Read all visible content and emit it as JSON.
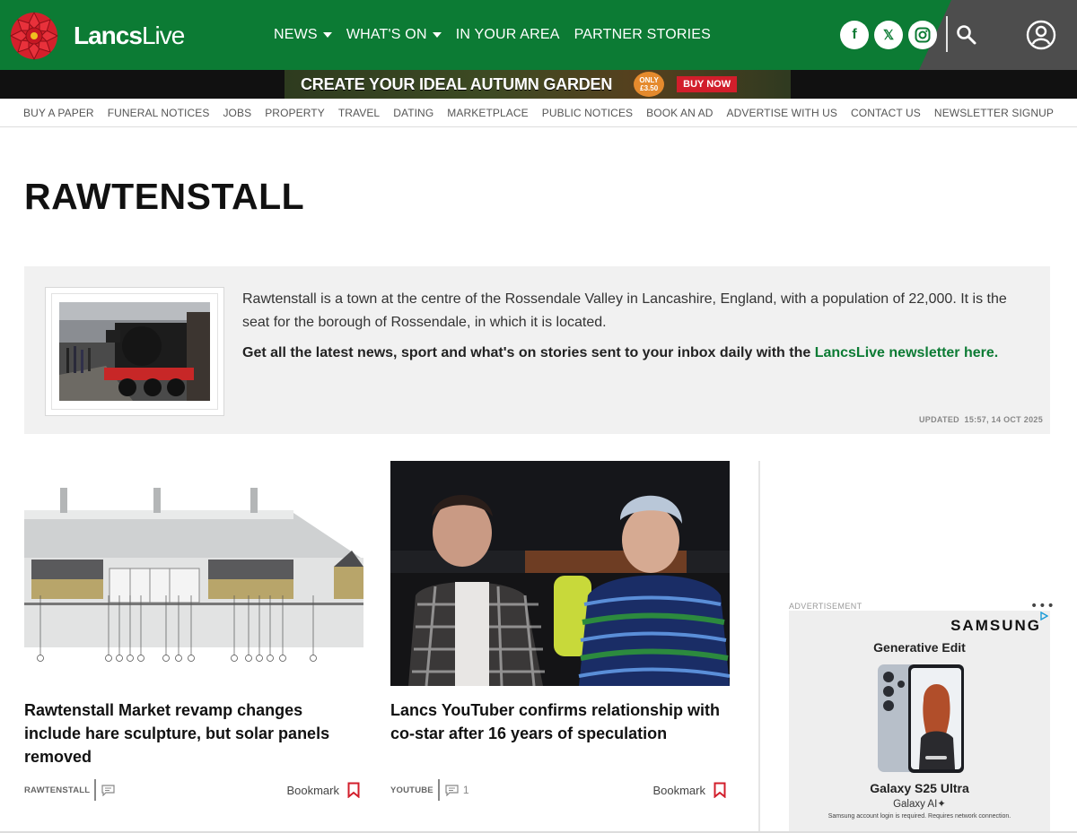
{
  "header": {
    "logo": {
      "lancs": "Lancs",
      "live": "Live"
    },
    "nav": [
      {
        "label": "NEWS",
        "dropdown": true
      },
      {
        "label": "WHAT'S ON",
        "dropdown": true
      },
      {
        "label": "IN YOUR AREA",
        "dropdown": false
      },
      {
        "label": "PARTNER STORIES",
        "dropdown": false
      }
    ],
    "socials": [
      {
        "name": "facebook",
        "glyph": "f"
      },
      {
        "name": "x",
        "glyph": "𝕏"
      },
      {
        "name": "instagram",
        "glyph": "◎"
      }
    ],
    "colors": {
      "brand_green": "#0c7b34",
      "dark_grey": "#4d4d4d"
    }
  },
  "promo": {
    "text": "CREATE YOUR IDEAL AUTUMN GARDEN",
    "badge_top": "ONLY",
    "badge_price": "£3.50",
    "button": "BUY NOW"
  },
  "subnav": [
    "BUY A PAPER",
    "FUNERAL NOTICES",
    "JOBS",
    "PROPERTY",
    "TRAVEL",
    "DATING",
    "MARKETPLACE",
    "PUBLIC NOTICES",
    "BOOK AN AD",
    "ADVERTISE WITH US",
    "CONTACT US",
    "NEWSLETTER SIGNUP"
  ],
  "page": {
    "title": "RAWTENSTALL"
  },
  "topic": {
    "description": "Rawtenstall is a town at the centre of the Rossendale Valley in Lancashire, England, with a population of 22,000. It is the seat for the borough of Rossendale, in which it is located.",
    "cta_text": "Get all the latest news, sport and what's on stories sent to your inbox daily with the ",
    "cta_link": "LancsLive newsletter here.",
    "updated_label": "UPDATED",
    "updated_value": "15:57, 14 OCT 2025"
  },
  "articles": [
    {
      "headline": "Rawtenstall Market revamp changes include hare sculpture, but solar panels removed",
      "tag": "RAWTENSTALL",
      "comments": "",
      "bookmark": "Bookmark"
    },
    {
      "headline": "Lancs YouTuber confirms relationship with co-star after 16 years of speculation",
      "tag": "YOUTUBE",
      "comments": "1",
      "bookmark": "Bookmark"
    }
  ],
  "ad": {
    "label": "ADVERTISEMENT",
    "dots": "•••",
    "brand": "SAMSUNG",
    "title": "Generative Edit",
    "product": "Galaxy S25 Ultra",
    "sub": "Galaxy AI✦",
    "fine": "Samsung account login is required. Requires network connection."
  }
}
